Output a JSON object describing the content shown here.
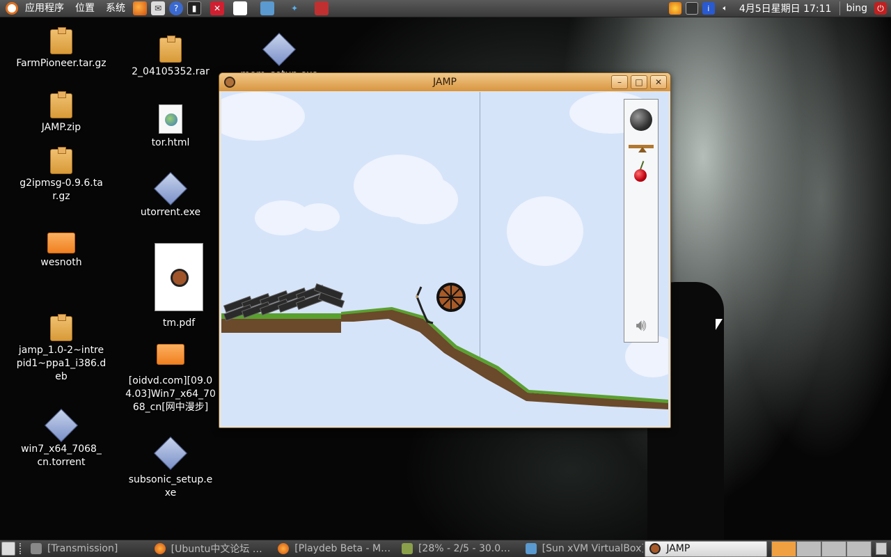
{
  "top_panel": {
    "menus": [
      "应用程序",
      "位置",
      "系统"
    ],
    "clock": "4月5日星期日 17:11",
    "user": "bing"
  },
  "desktop": {
    "icons": [
      {
        "label": "FarmPioneer.tar.gz",
        "type": "package"
      },
      {
        "label": "JAMP.zip",
        "type": "package"
      },
      {
        "label": "g2ipmsg-0.9.6.tar.gz",
        "type": "package"
      },
      {
        "label": "wesnoth",
        "type": "folder"
      },
      {
        "label": "jamp_1.0-2~intrepid1~ppa1_i386.deb",
        "type": "package"
      },
      {
        "label": "win7_x64_7068_cn.torrent",
        "type": "exe"
      },
      {
        "label": "2_04105352.rar",
        "type": "package"
      },
      {
        "label": "tor.html",
        "type": "html"
      },
      {
        "label": "utorrent.exe",
        "type": "exe"
      },
      {
        "label": "tm.pdf",
        "type": "pdf"
      },
      {
        "label": "[oidvd.com][09.04.03]Win7_x64_7068_cn[网中漫步]",
        "type": "folder"
      },
      {
        "label": "subsonic_setup.exe",
        "type": "exe"
      },
      {
        "label": "mem_setup.exe",
        "type": "exe"
      }
    ]
  },
  "jamp_window": {
    "title": "JAMP",
    "buttons": {
      "minimize": "–",
      "maximize": "□",
      "close": "✕"
    },
    "toolbox": [
      "bowling-ball",
      "seesaw",
      "cherry",
      "speaker"
    ]
  },
  "bottom_panel": {
    "tasks": [
      {
        "label": "[Transmission]",
        "active": false
      },
      {
        "label": "[Ubuntu中文论坛 …",
        "active": false
      },
      {
        "label": "[Playdeb Beta - M…",
        "active": false
      },
      {
        "label": "[28% - 2/5 - 30.0…",
        "active": false
      },
      {
        "label": "[Sun xVM VirtualBox]",
        "active": false
      },
      {
        "label": "JAMP",
        "active": true
      }
    ]
  },
  "colors": {
    "title_gradient_top": "#f2c98a",
    "title_gradient_bottom": "#d8953f",
    "sky": "#d6e4fa",
    "grass": "#5aa030",
    "dirt": "#6a4a2a"
  }
}
